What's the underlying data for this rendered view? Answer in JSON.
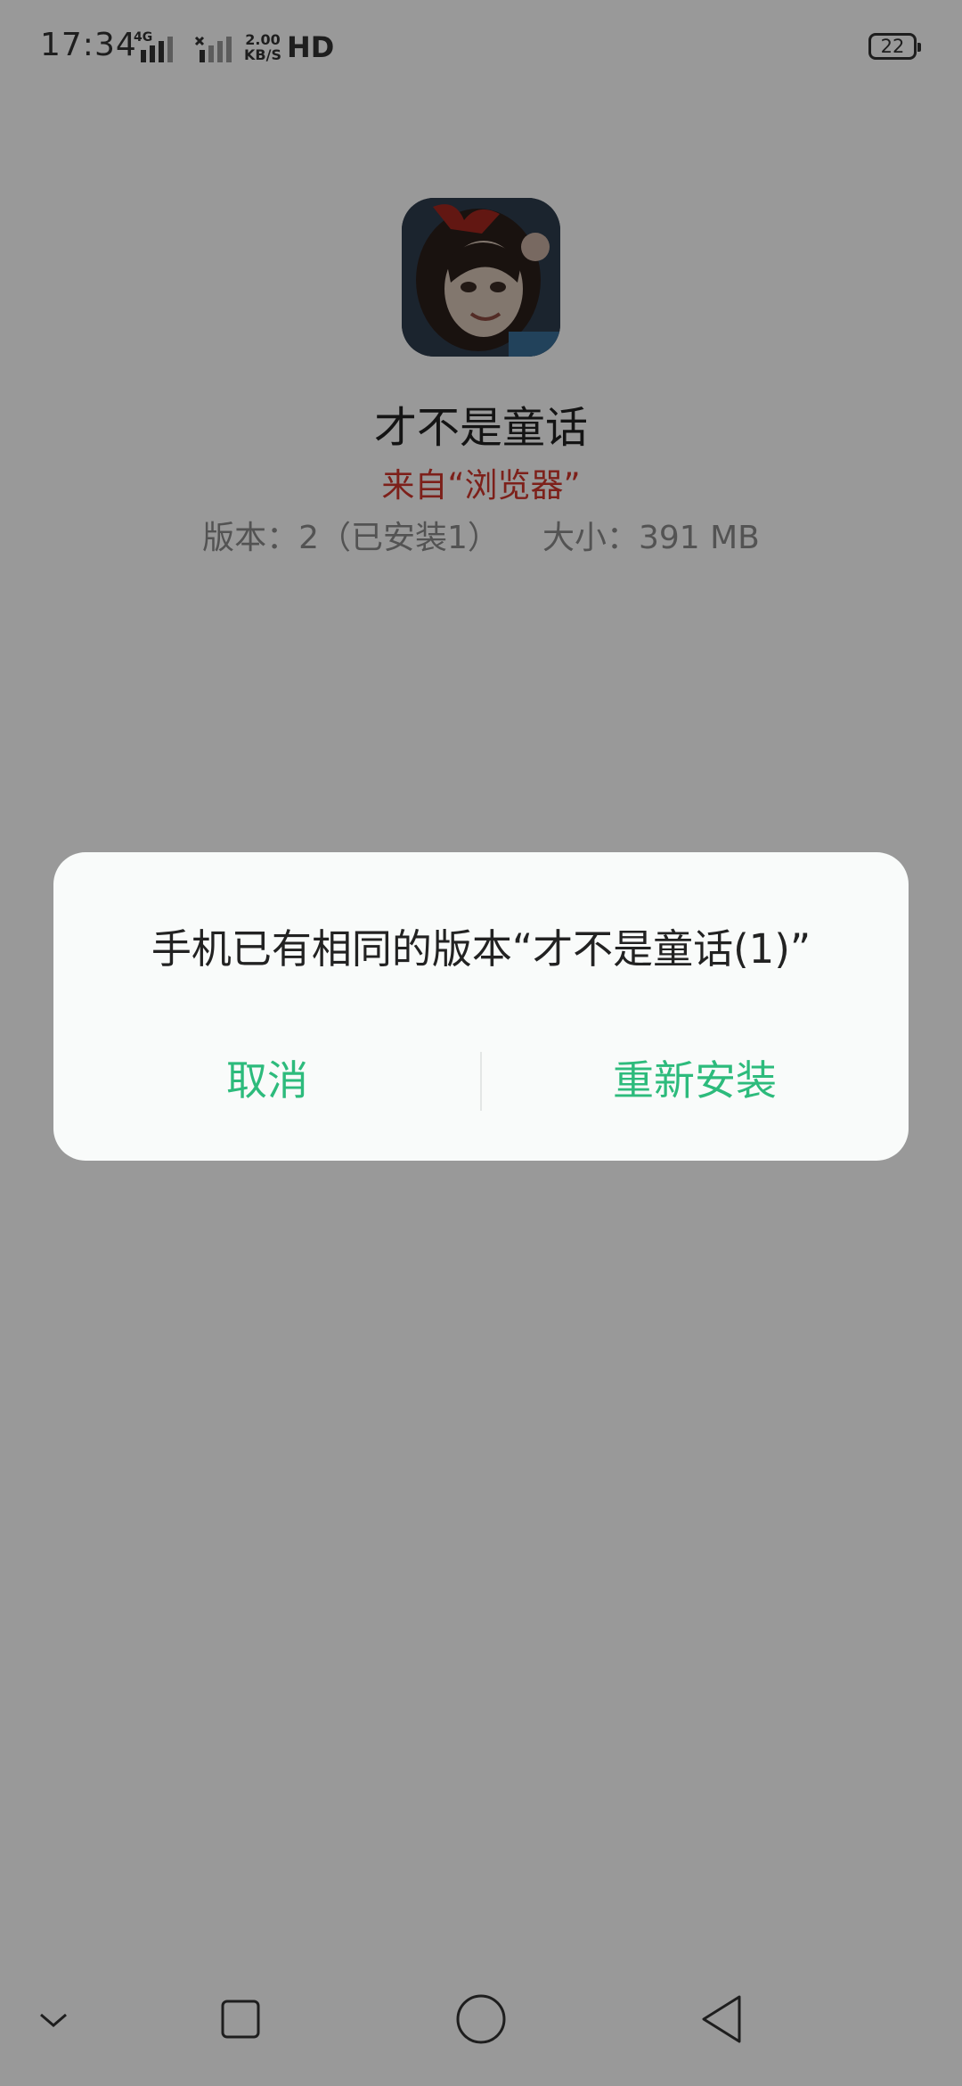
{
  "status_bar": {
    "time": "17:34",
    "network": "4G",
    "speed_value": "2.00",
    "speed_unit": "KB/S",
    "hd": "HD",
    "battery": "22"
  },
  "app": {
    "name": "才不是童话",
    "source": "来自“浏览器”",
    "version": "版本：2（已安装1）",
    "size": "大小：391 MB"
  },
  "dialog": {
    "message": "手机已有相同的版本“才不是童话(1)”",
    "cancel_label": "取消",
    "reinstall_label": "重新安装",
    "button_color": "#2dbb7c"
  },
  "navigation": {
    "icons": [
      "chevron-down-icon",
      "square-recent-icon",
      "circle-home-icon",
      "triangle-back-icon"
    ]
  }
}
